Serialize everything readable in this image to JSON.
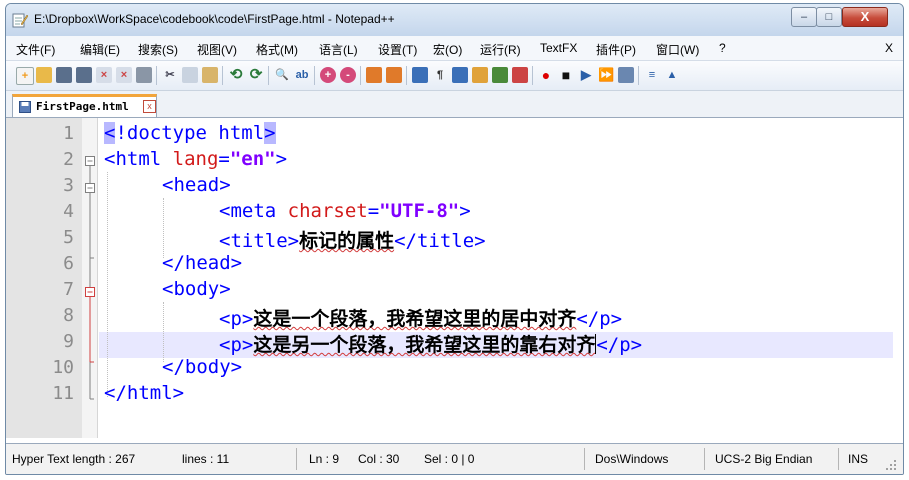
{
  "window": {
    "title": "E:\\Dropbox\\WorkSpace\\codebook\\code\\FirstPage.html - Notepad++",
    "minimize": "–",
    "maximize": "□",
    "close": "X"
  },
  "menu": {
    "items": [
      "文件(F)",
      "编辑(E)",
      "搜索(S)",
      "视图(V)",
      "格式(M)",
      "语言(L)",
      "设置(T)",
      "宏(O)",
      "运行(R)",
      "TextFX",
      "插件(P)",
      "窗口(W)",
      "?"
    ],
    "close": "X"
  },
  "toolbar": {
    "icons": [
      "new-file",
      "open-file",
      "save",
      "save-all",
      "close",
      "close-all",
      "print",
      "cut",
      "copy",
      "paste",
      "undo",
      "redo",
      "find",
      "replace",
      "zoom-in",
      "zoom-out",
      "sync-v",
      "sync-h",
      "word-wrap",
      "show-all",
      "indent-guide",
      "user-lang",
      "doc-map",
      "func-list",
      "record-macro",
      "stop-macro",
      "play-macro",
      "run-macro-multiple",
      "save-macro",
      "textfx-a",
      "textfx-b"
    ]
  },
  "tab": {
    "label": "FirstPage.html",
    "close": "x"
  },
  "editor": {
    "lines": [
      {
        "n": "1",
        "code": {
          "open": "<",
          "rest": "!doctype html",
          "close": ">"
        }
      },
      {
        "n": "2",
        "code": {
          "t1": "<html ",
          "a1": "lang",
          "eq": "=",
          "s1": "\"en\"",
          "t2": ">"
        }
      },
      {
        "n": "3",
        "code": {
          "t1": "<head>"
        }
      },
      {
        "n": "4",
        "code": {
          "t1": "<meta ",
          "a1": "charset",
          "eq": "=",
          "s1": "\"UTF-8\"",
          "t2": ">"
        }
      },
      {
        "n": "5",
        "code": {
          "t1": "<title>",
          "txt": "标记的属性",
          "t2": "</title>"
        }
      },
      {
        "n": "6",
        "code": {
          "t1": "</head>"
        }
      },
      {
        "n": "7",
        "code": {
          "t1": "<body>"
        }
      },
      {
        "n": "8",
        "code": {
          "t1": "<p>",
          "txt": "这是一个段落，我希望这里的居中对齐",
          "t2": "</p>"
        }
      },
      {
        "n": "9",
        "code": {
          "t1": "<p>",
          "txt": "这是另一个段落，我希望这里的靠右对齐",
          "t2": "</p>"
        }
      },
      {
        "n": "10",
        "code": {
          "t1": "</body>"
        }
      },
      {
        "n": "11",
        "code": {
          "t1": "</html>"
        }
      }
    ]
  },
  "status": {
    "type": "Hyper Text length : 267",
    "lines": "lines : 11",
    "ln": "Ln : 9",
    "col": "Col : 30",
    "sel": "Sel : 0 | 0",
    "eol": "Dos\\Windows",
    "encoding": "UCS-2 Big Endian",
    "mode": "INS"
  }
}
